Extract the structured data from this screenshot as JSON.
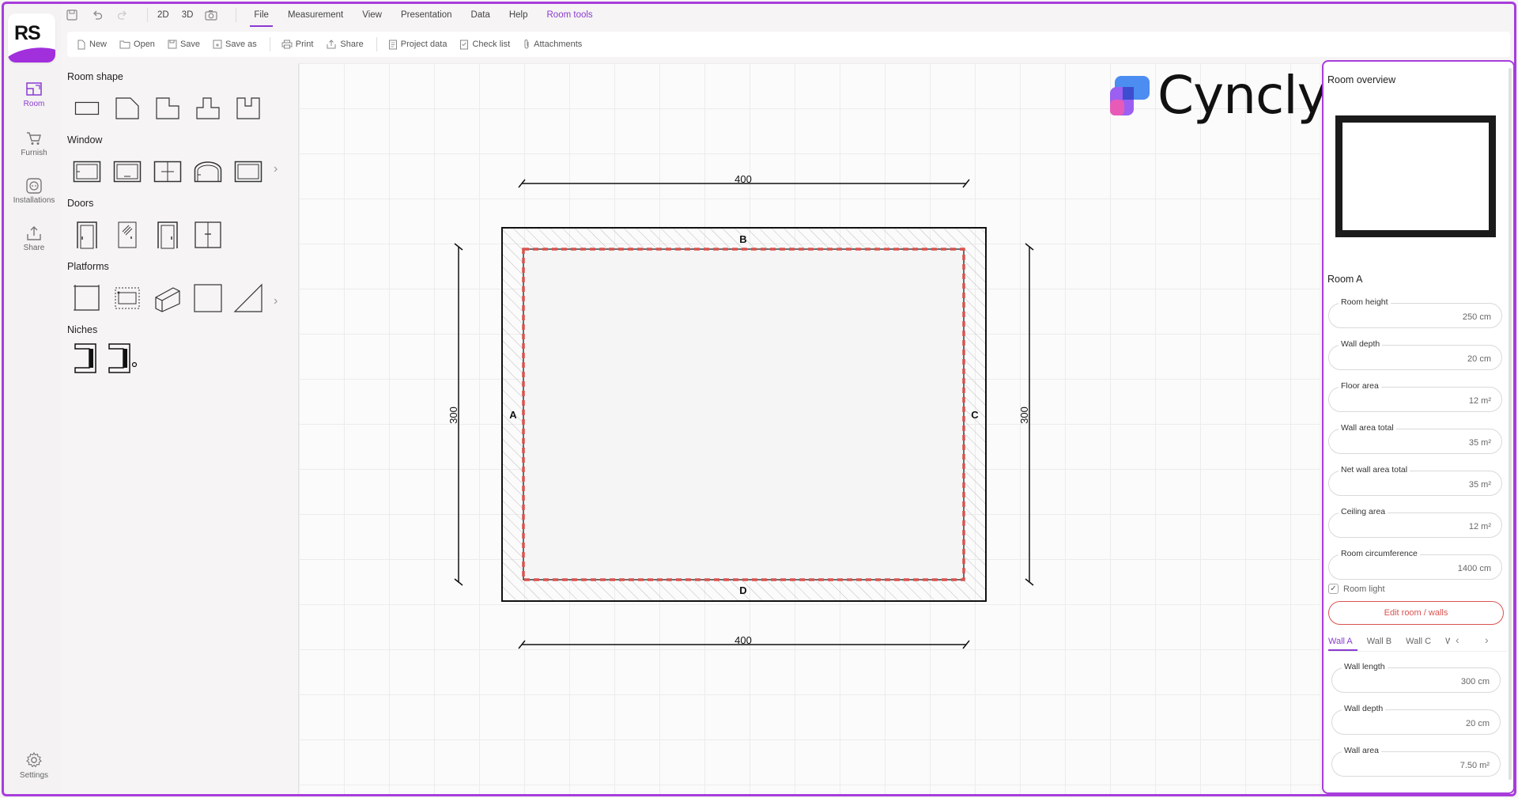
{
  "menubar": {
    "view2d": "2D",
    "view3d": "3D",
    "items": [
      "File",
      "Measurement",
      "View",
      "Presentation",
      "Data",
      "Help",
      "Room tools"
    ]
  },
  "toolbar": {
    "new": "New",
    "open": "Open",
    "save": "Save",
    "save_as": "Save as",
    "print": "Print",
    "share": "Share",
    "project_data": "Project data",
    "check_list": "Check list",
    "attachments": "Attachments"
  },
  "rail": {
    "logo": "RS",
    "room": "Room",
    "furnish": "Furnish",
    "installations": "Installations",
    "share": "Share",
    "settings": "Settings"
  },
  "palette": {
    "room_shape": "Room shape",
    "window": "Window",
    "doors": "Doors",
    "platforms": "Platforms",
    "niches": "Niches"
  },
  "brand": {
    "name": "Cyncly"
  },
  "plan": {
    "top_dim": "400",
    "bottom_dim": "400",
    "left_dim": "300",
    "right_dim": "300",
    "wall_a": "A",
    "wall_b": "B",
    "wall_c": "C",
    "wall_d": "D"
  },
  "panel": {
    "overview_title": "Room overview",
    "room_name": "Room A",
    "fields": [
      {
        "label": "Room height",
        "value": "250 cm"
      },
      {
        "label": "Wall depth",
        "value": "20 cm"
      },
      {
        "label": "Floor area",
        "value": "12 m²"
      },
      {
        "label": "Wall area total",
        "value": "35 m²"
      },
      {
        "label": "Net wall area total",
        "value": "35 m²"
      },
      {
        "label": "Ceiling area",
        "value": "12 m²"
      },
      {
        "label": "Room circumference",
        "value": "1400 cm"
      }
    ],
    "room_light": "Room light",
    "edit_button": "Edit room / walls",
    "tabs": [
      "Wall A",
      "Wall B",
      "Wall C",
      "W"
    ],
    "wall_fields": [
      {
        "label": "Wall length",
        "value": "300 cm"
      },
      {
        "label": "Wall depth",
        "value": "20 cm"
      },
      {
        "label": "Wall area",
        "value": "7.50 m²"
      }
    ]
  },
  "colors": {
    "accent": "#8a3bd1",
    "frame": "#a83ddb",
    "wall_highlight": "#d9534f"
  }
}
